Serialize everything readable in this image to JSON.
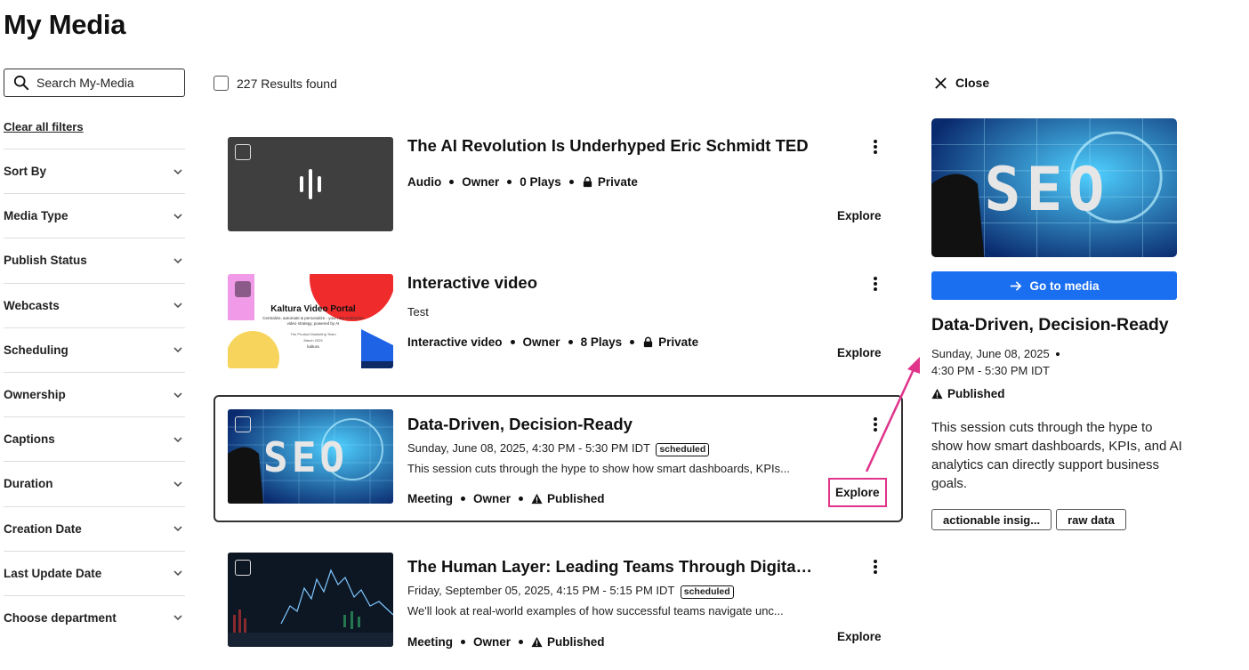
{
  "page": {
    "title": "My Media"
  },
  "sidebar": {
    "search_placeholder": "Search My-Media",
    "clear_filters": "Clear all filters",
    "filters": [
      {
        "label": "Sort By"
      },
      {
        "label": "Media Type"
      },
      {
        "label": "Publish Status"
      },
      {
        "label": "Webcasts"
      },
      {
        "label": "Scheduling"
      },
      {
        "label": "Ownership"
      },
      {
        "label": "Captions"
      },
      {
        "label": "Duration"
      },
      {
        "label": "Creation Date"
      },
      {
        "label": "Last Update Date"
      },
      {
        "label": "Choose department"
      }
    ]
  },
  "results": {
    "count_label": "227 Results found",
    "items": [
      {
        "title": "The AI Revolution Is Underhyped Eric Schmidt TED",
        "meta": [
          "Audio",
          "Owner",
          "0 Plays",
          "Private"
        ],
        "explore": "Explore"
      },
      {
        "title": "Interactive video",
        "subtitle": "Test",
        "meta": [
          "Interactive video",
          "Owner",
          "8 Plays",
          "Private"
        ],
        "explore": "Explore",
        "thumb_title": "Kaltura Video Portal",
        "thumb_subtitle": "Centralize, automate & personalize - your new enterprise video strategy, powered by AI",
        "thumb_team": "The Product Marketing Team",
        "thumb_date": "March 2025",
        "thumb_brand": "kaltura"
      },
      {
        "title": "Data-Driven, Decision-Ready",
        "date": "Sunday, June 08, 2025, 4:30 PM - 5:30 PM IDT",
        "badge": "scheduled",
        "description": "This session cuts through the hype to show how smart dashboards, KPIs...",
        "meta": [
          "Meeting",
          "Owner",
          "Published"
        ],
        "explore": "Explore"
      },
      {
        "title": "The Human Layer: Leading Teams Through Digital ...",
        "date": "Friday, September 05, 2025, 4:15 PM - 5:15 PM IDT",
        "badge": "scheduled",
        "description": "We'll look at real-world examples of how successful teams navigate unc...",
        "meta": [
          "Meeting",
          "Owner",
          "Published"
        ],
        "explore": "Explore"
      }
    ]
  },
  "panel": {
    "close_label": "Close",
    "goto_label": "Go to media",
    "title": "Data-Driven, Decision-Ready",
    "date_line1": "Sunday, June 08, 2025",
    "date_line2": "4:30 PM - 5:30 PM IDT",
    "status": "Published",
    "description": "This session cuts through the hype to show how smart dashboards, KPIs, and AI analytics can directly support business goals.",
    "tags": [
      "actionable insig...",
      "raw data"
    ]
  },
  "colors": {
    "accent_blue": "#1a6ff0",
    "highlight_pink": "#e0338a",
    "selected_border": "#333333"
  }
}
